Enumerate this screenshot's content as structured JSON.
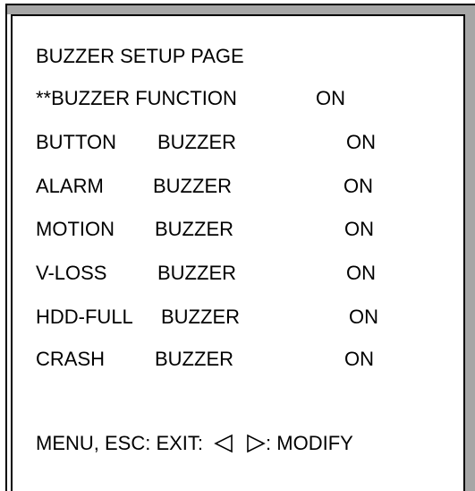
{
  "title": "BUZZER SETUP PAGE",
  "function_row": {
    "label": "**BUZZER FUNCTION",
    "value": "ON"
  },
  "buzzers": [
    {
      "name": "BUTTON",
      "label": "BUZZER",
      "value": "ON"
    },
    {
      "name": "ALARM",
      "label": "BUZZER",
      "value": "ON"
    },
    {
      "name": "MOTION",
      "label": "BUZZER",
      "value": "ON"
    },
    {
      "name": "V-LOSS",
      "label": "BUZZER",
      "value": "ON"
    },
    {
      "name": "HDD-FULL",
      "label": "BUZZER",
      "value": "ON"
    },
    {
      "name": "CRASH",
      "label": "BUZZER",
      "value": "ON"
    }
  ],
  "footer": {
    "exit_text": "MENU, ESC: EXIT:",
    "modify_text": ": MODIFY",
    "left_arrow_icon": "left-triangle-icon",
    "right_arrow_icon": "right-triangle-icon"
  }
}
